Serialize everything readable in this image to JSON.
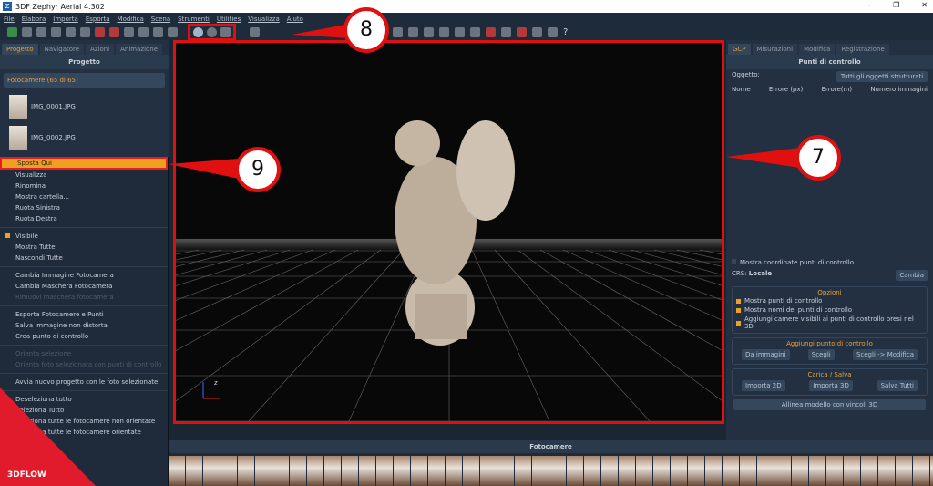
{
  "window": {
    "title": "3DF Zephyr Aerial 4.302"
  },
  "menu": [
    "File",
    "Elabora",
    "Importa",
    "Esporta",
    "Modifica",
    "Scena",
    "Strumenti",
    "Utilities",
    "Visualizza",
    "Aiuto"
  ],
  "left": {
    "tabs": [
      "Progetto",
      "Navigatore",
      "Azioni",
      "Animazione"
    ],
    "panel_title": "Progetto",
    "cameras_header": "Fotocamere (65 di 65)",
    "images": [
      "IMG_0001.JPG",
      "IMG_0002.JPG"
    ]
  },
  "context_menu": {
    "items": [
      {
        "label": "Sposta Qui",
        "state": "highlighted"
      },
      {
        "label": "Visualizza"
      },
      {
        "label": "Rinomina"
      },
      {
        "label": "Mostra cartella..."
      },
      {
        "label": "Ruota Sinistra"
      },
      {
        "label": "Ruota Destra"
      },
      {
        "label": "Visibile",
        "checked": true
      },
      {
        "label": "Mostra Tutte"
      },
      {
        "label": "Nascondi Tutte"
      },
      {
        "label": "Cambia Immagine Fotocamera"
      },
      {
        "label": "Cambia Maschera Fotocamera"
      },
      {
        "label": "Rimuovi maschera fotocamera",
        "disabled": true
      },
      {
        "label": "Esporta Fotocamere e Punti"
      },
      {
        "label": "Salva immagine non distorta"
      },
      {
        "label": "Crea punto di controllo"
      },
      {
        "label": "Orienta selezione",
        "disabled": true
      },
      {
        "label": "Orienta foto selezionata con punti di controllo",
        "disabled": true
      },
      {
        "label": "Avvia nuovo progetto con le foto selezionate"
      },
      {
        "label": "Deseleziona tutto"
      },
      {
        "label": "Seleziona Tutto"
      },
      {
        "label": "Seleziona tutte le fotocamere non orientate"
      },
      {
        "label": "Seleziona tutte le fotocamere orientate"
      }
    ]
  },
  "right": {
    "tabs": [
      "GCP",
      "Misurazioni",
      "Modifica",
      "Registrazione"
    ],
    "panel_title": "Punti di controllo",
    "object_label": "Oggetto:",
    "object_value": "Tutti gli oggetti strutturati",
    "columns": [
      "Nome",
      "Errore (px)",
      "Errore(m)",
      "Numero immagini"
    ],
    "show_coords": "Mostra coordinate punti di controllo",
    "crs_label": "CRS:",
    "crs_value": "Locale",
    "change": "Cambia",
    "options_title": "Opzioni",
    "options": [
      "Mostra punti di controllo",
      "Mostra nomi dei punti di controllo",
      "Aggiungi camere visibili ai punti di controllo presi nel 3D"
    ],
    "add_title": "Aggiungi punto di controllo",
    "add_buttons": [
      "Da immagini",
      "Scegli",
      "Scegli -> Modifica"
    ],
    "load_title": "Carica / Salva",
    "load_buttons": [
      "Importa 2D",
      "Importa 3D",
      "Salva Tutti"
    ],
    "align": "Allinea modello con vincoli 3D"
  },
  "bottom": {
    "title": "Fotocamere"
  },
  "axis": {
    "z": "z"
  },
  "callouts": [
    "8",
    "9",
    "7"
  ],
  "brand": "3DFLOW",
  "colors": {
    "accent": "#f0a020",
    "callout": "#e01010",
    "brand": "#e21b2c"
  }
}
